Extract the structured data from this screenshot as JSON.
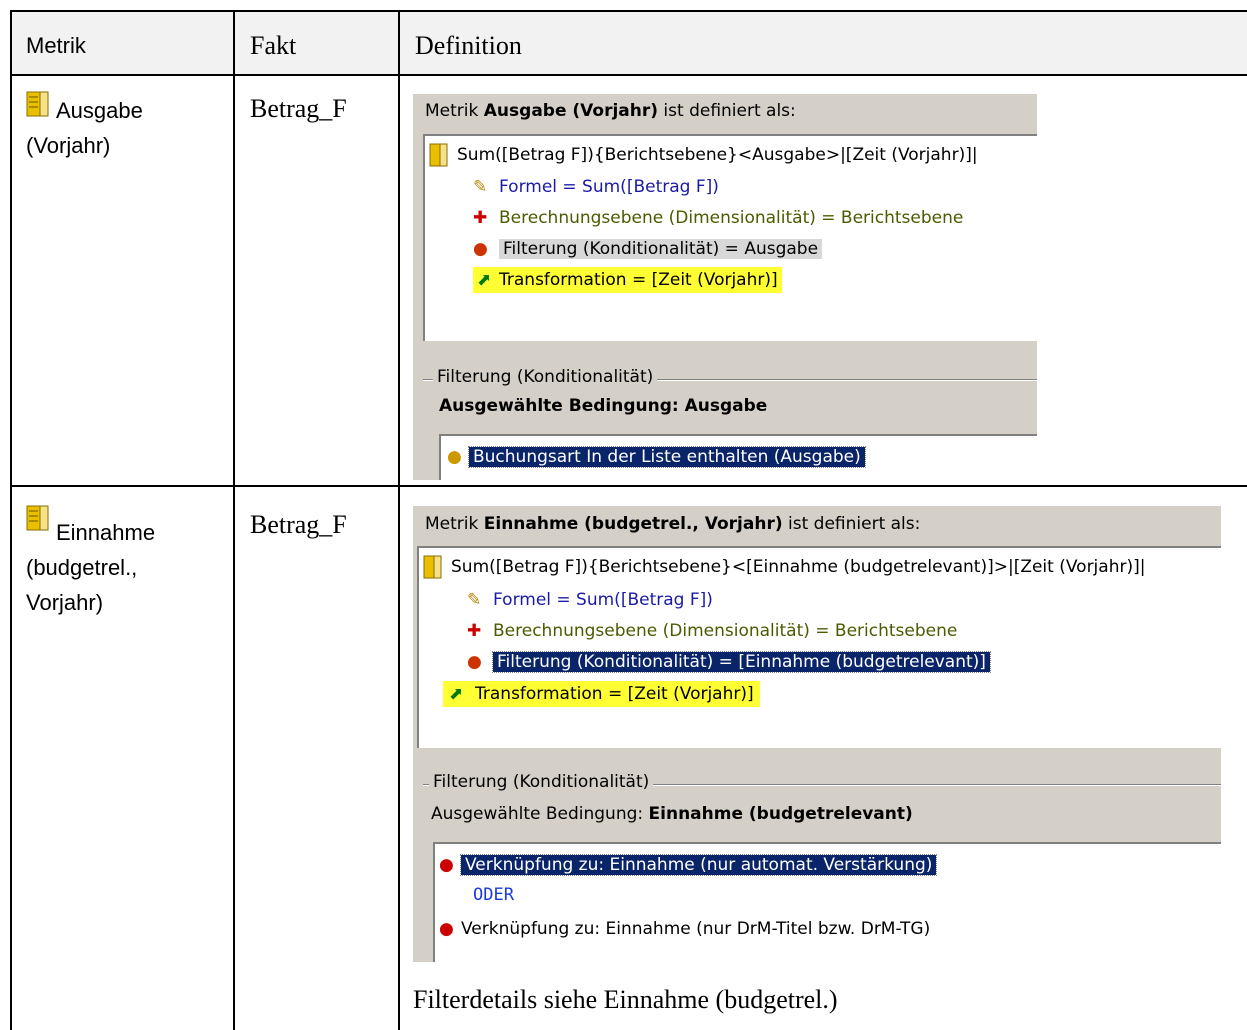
{
  "table": {
    "headers": {
      "metrik": "Metrik",
      "fakt": "Fakt",
      "definition": "Definition"
    },
    "rows": [
      {
        "metrik_line1": "Ausgabe",
        "metrik_line2": "(Vorjahr)",
        "fakt": "Betrag_F",
        "definition": {
          "title_prefix": "Metrik ",
          "title_bold": "Ausgabe (Vorjahr)",
          "title_suffix": " ist definiert als:",
          "tree": {
            "root": "Sum([Betrag F]){Berichtsebene}<Ausgabe>|[Zeit (Vorjahr)]|",
            "formel": "Formel = Sum([Betrag F])",
            "berechnung": "Berechnungsebene (Dimensionalität) = Berichtsebene",
            "filterung": "Filterung (Konditionalität) = Ausgabe",
            "transformation": "Transformation = [Zeit (Vorjahr)]"
          },
          "group_label": "Filterung (Konditionalität)",
          "selected_label": "Ausgewählte Bedingung: ",
          "selected_value": "Ausgabe",
          "conditions": [
            "Buchungsart In der Liste enthalten (Ausgabe)"
          ]
        }
      },
      {
        "metrik_line1": "Einnahme",
        "metrik_line2": "(budgetrel.,",
        "metrik_line3": "Vorjahr)",
        "fakt": "Betrag_F",
        "definition": {
          "title_prefix": "Metrik ",
          "title_bold": "Einnahme (budgetrel., Vorjahr)",
          "title_suffix": " ist definiert als:",
          "tree": {
            "root": "Sum([Betrag F]){Berichtsebene}<[Einnahme (budgetrelevant)]>|[Zeit (Vorjahr)]|",
            "formel": "Formel = Sum([Betrag F])",
            "berechnung": "Berechnungsebene (Dimensionalität) = Berichtsebene",
            "filterung": "Filterung (Konditionalität) = [Einnahme (budgetrelevant)]",
            "transformation": "Transformation = [Zeit (Vorjahr)]"
          },
          "group_label": "Filterung (Konditionalität)",
          "selected_label": "Ausgewählte Bedingung: ",
          "selected_value": "Einnahme (budgetrelevant)",
          "conditions": [
            "Verknüpfung zu: Einnahme (nur automat. Verstärkung)",
            "ODER",
            "Verknüpfung zu: Einnahme (nur DrM-Titel bzw. DrM-TG)"
          ]
        },
        "note": "Filterdetails siehe Einnahme (budgetrel.)"
      }
    ]
  }
}
